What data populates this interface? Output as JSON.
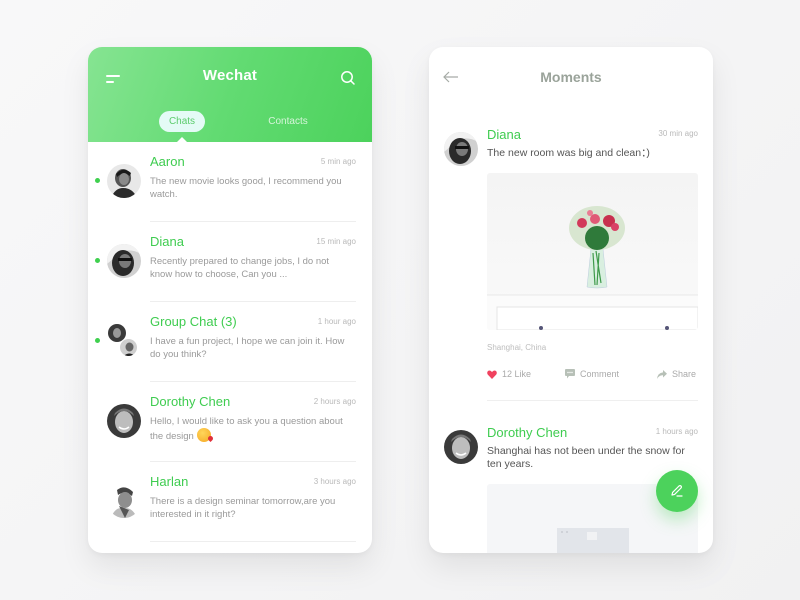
{
  "colors": {
    "accent_green": "#3fcc50",
    "header_gradient_start": "#86e492",
    "header_gradient_end": "#4cd25c",
    "like_red": "#f0425f",
    "fab_green": "#4cd25c"
  },
  "chats_screen": {
    "header": {
      "menu_icon": "menu-icon",
      "title": "Wechat",
      "search_icon": "search-icon"
    },
    "tabs": [
      {
        "label": "Chats",
        "active": true
      },
      {
        "label": "Contacts",
        "active": false
      }
    ],
    "conversations": [
      {
        "name": "Aaron",
        "time": "5 min ago",
        "message": "The new movie looks good, I recommend you watch.",
        "online": true,
        "avatar": "avatar-aaron"
      },
      {
        "name": "Diana",
        "time": "15 min ago",
        "message": "Recently prepared to change jobs, I do not know how to choose,  Can you ...",
        "online": true,
        "avatar": "avatar-diana"
      },
      {
        "name": "Group Chat",
        "count": "(3)",
        "time": "1 hour ago",
        "message": "I have a fun project, I hope we can join it. How do you think?",
        "online": true,
        "avatar": "avatar-group"
      },
      {
        "name": "Dorothy Chen",
        "time": "2 hours ago",
        "message": "Hello, I would like to ask you a question about the design",
        "emoji": "kissing-face-emoji",
        "online": false,
        "avatar": "avatar-dorothy"
      },
      {
        "name": "Harlan",
        "time": "3 hours ago",
        "message": "There is a design seminar tomorrow,are you interested in it right?",
        "online": false,
        "avatar": "avatar-harlan"
      }
    ]
  },
  "moments_screen": {
    "header": {
      "back_icon": "arrow-left-icon",
      "title": "Moments"
    },
    "posts": [
      {
        "name": "Diana",
        "time": "30 min ago",
        "text": "The new room was big and clean：)",
        "image": "flowers-in-vase-photo",
        "location": "Shanghai, China",
        "likes": "12 Like",
        "comment_label": "Comment",
        "share_label": "Share"
      },
      {
        "name": "Dorothy Chen",
        "time": "1 hours ago",
        "text": "Shanghai has not been under the snow for ten years.",
        "image": "snowy-scene-photo"
      }
    ],
    "fab_icon": "edit-pencil-icon"
  }
}
